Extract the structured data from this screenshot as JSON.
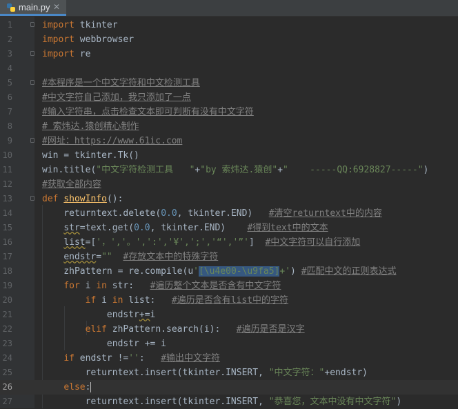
{
  "editor": {
    "tab": {
      "file_name": "main.py",
      "icon": "python-file-icon",
      "close_icon": "close-icon"
    },
    "current_line": 26,
    "colors": {
      "background": "#2b2b2b",
      "keyword": "#cc7832",
      "string": "#6a8759",
      "number": "#6897bb",
      "comment": "#808080",
      "function": "#ffc66d",
      "text": "#a9b7c6"
    }
  },
  "lines": [
    {
      "n": "1",
      "t": [
        [
          "kw",
          "import"
        ],
        [
          "id",
          " tkinter"
        ]
      ]
    },
    {
      "n": "2",
      "t": [
        [
          "kw",
          "import"
        ],
        [
          "id",
          " webbrowser"
        ]
      ]
    },
    {
      "n": "3",
      "t": [
        [
          "kw",
          "import"
        ],
        [
          "id",
          " re"
        ]
      ]
    },
    {
      "n": "4",
      "t": []
    },
    {
      "n": "5",
      "t": [
        [
          "cmt",
          "#本程序是一个中文字符和中文检测工具"
        ]
      ]
    },
    {
      "n": "6",
      "t": [
        [
          "cmt",
          "#中文字符自己添加，我只添加了一点"
        ]
      ]
    },
    {
      "n": "7",
      "t": [
        [
          "cmt",
          "#输入字符串，点击检查文本即可判断有没有中文字符"
        ]
      ]
    },
    {
      "n": "8",
      "t": [
        [
          "cmt",
          "# 索炜达.猿创精心制作"
        ]
      ]
    },
    {
      "n": "9",
      "t": [
        [
          "cmt",
          "#网址：https://www.61ic.com"
        ]
      ]
    },
    {
      "n": "10",
      "t": [
        [
          "id",
          "win = tkinter.Tk()"
        ]
      ]
    },
    {
      "n": "11",
      "t": [
        [
          "id",
          "win.title("
        ],
        [
          "str",
          "\"中文字符检测工具   \""
        ],
        [
          "id",
          "+"
        ],
        [
          "str",
          "\"by 索炜达.猿创\""
        ],
        [
          "id",
          "+"
        ],
        [
          "str",
          "\"    -----QQ:6928827-----\""
        ],
        [
          "id",
          ")"
        ]
      ]
    },
    {
      "n": "12",
      "t": [
        [
          "cmt",
          "#获取全部内容"
        ]
      ]
    },
    {
      "n": "13",
      "t": [
        [
          "kw",
          "def "
        ],
        [
          "fn",
          "showInfo"
        ],
        [
          "id",
          "():"
        ]
      ]
    },
    {
      "n": "14",
      "t": [
        [
          "id",
          "    returntext.delete("
        ],
        [
          "num",
          "0.0"
        ],
        [
          "id",
          ", tkinter.END)   "
        ],
        [
          "cmt",
          "#清空returntext中的内容"
        ]
      ]
    },
    {
      "n": "15",
      "t": [
        [
          "id",
          "    "
        ],
        [
          "sq",
          "str"
        ],
        [
          "id",
          "=text.get("
        ],
        [
          "num",
          "0.0"
        ],
        [
          "id",
          ", tkinter.END)    "
        ],
        [
          "cmt",
          "#得到text中的文本"
        ]
      ]
    },
    {
      "n": "16",
      "t": [
        [
          "id",
          "    "
        ],
        [
          "sq",
          "list"
        ],
        [
          "id",
          "=["
        ],
        [
          "str",
          "'，','。',':','¥',';','“','”'"
        ],
        [
          "id",
          "]  "
        ],
        [
          "cmt",
          "#中文字符可以自行添加"
        ]
      ]
    },
    {
      "n": "17",
      "t": [
        [
          "id",
          "    "
        ],
        [
          "sq",
          "endstr"
        ],
        [
          "id",
          "="
        ],
        [
          "str",
          "\"\""
        ],
        [
          "id",
          "  "
        ],
        [
          "cmt",
          "#存放文本中的特殊字符"
        ]
      ]
    },
    {
      "n": "18",
      "t": [
        [
          "id",
          "    zhPattern = re.compile(u"
        ],
        [
          "str",
          "'"
        ],
        [
          "hl",
          "[\\u4e00-\\u9fa5]"
        ],
        [
          "str",
          "+'"
        ],
        [
          "id",
          ") "
        ],
        [
          "cmt",
          "#匹配中文的正则表达式"
        ]
      ]
    },
    {
      "n": "19",
      "t": [
        [
          "id",
          "    "
        ],
        [
          "kw",
          "for"
        ],
        [
          "id",
          " i "
        ],
        [
          "kw",
          "in"
        ],
        [
          "id",
          " str:   "
        ],
        [
          "cmt",
          "#遍历整个文本是否含有中文字符"
        ]
      ]
    },
    {
      "n": "20",
      "t": [
        [
          "id",
          "        "
        ],
        [
          "kw",
          "if"
        ],
        [
          "id",
          " i "
        ],
        [
          "kw",
          "in"
        ],
        [
          "id",
          " list:   "
        ],
        [
          "cmt",
          "#遍历是否含有list中的字符"
        ]
      ]
    },
    {
      "n": "21",
      "t": [
        [
          "id",
          "            endstr"
        ],
        [
          "sq",
          "+="
        ],
        [
          "id",
          "i"
        ]
      ]
    },
    {
      "n": "22",
      "t": [
        [
          "id",
          "        "
        ],
        [
          "kw",
          "elif"
        ],
        [
          "id",
          " zhPattern.search(i):   "
        ],
        [
          "cmt",
          "#遍历是否是汉字"
        ]
      ]
    },
    {
      "n": "23",
      "t": [
        [
          "id",
          "            endstr += i"
        ]
      ]
    },
    {
      "n": "24",
      "t": [
        [
          "id",
          "    "
        ],
        [
          "kw",
          "if"
        ],
        [
          "id",
          " endstr !="
        ],
        [
          "str",
          "''"
        ],
        [
          "id",
          ":   "
        ],
        [
          "cmt",
          "#输出中文字符"
        ]
      ]
    },
    {
      "n": "25",
      "t": [
        [
          "id",
          "        returntext.insert(tkinter.INSERT, "
        ],
        [
          "str",
          "\"中文字符：\""
        ],
        [
          "id",
          "+endstr)"
        ]
      ]
    },
    {
      "n": "26",
      "t": [
        [
          "id",
          "    "
        ],
        [
          "kw",
          "else"
        ],
        [
          "id",
          ":"
        ]
      ]
    },
    {
      "n": "27",
      "t": [
        [
          "id",
          "        returntext.insert(tkinter.INSERT, "
        ],
        [
          "str",
          "\"恭喜您，文本中没有中文字符\""
        ],
        [
          "id",
          ")"
        ]
      ]
    }
  ]
}
